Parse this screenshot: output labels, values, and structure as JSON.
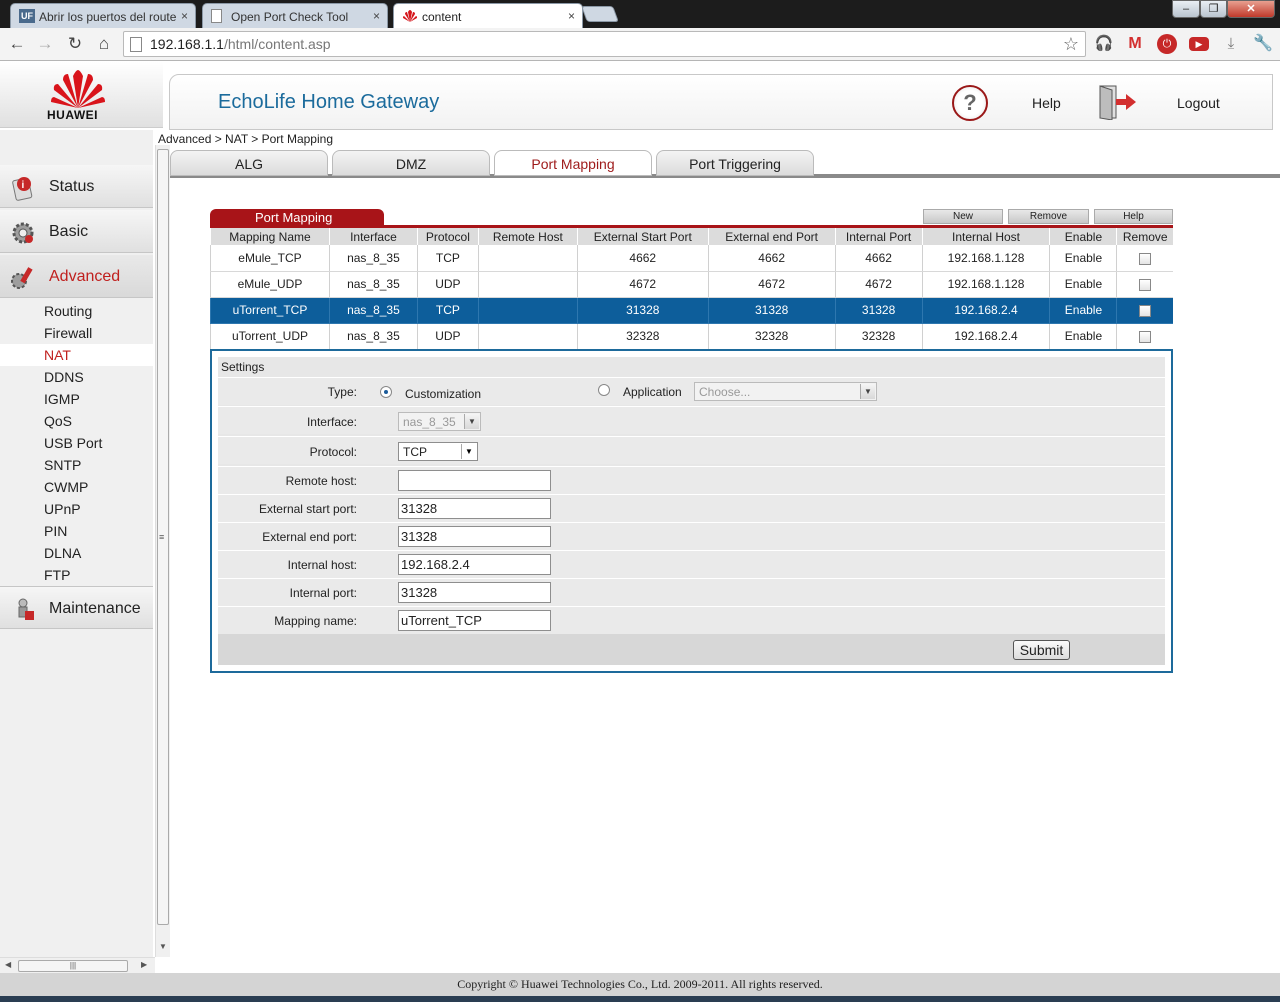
{
  "browser": {
    "tabs": [
      {
        "title": "Abrir los puertos del route",
        "icon": "uf-favicon-icon",
        "active": false
      },
      {
        "title": "Open Port Check Tool",
        "icon": "page-icon",
        "active": false
      },
      {
        "title": "content",
        "icon": "huawei-favicon-icon",
        "active": true
      }
    ],
    "close_glyph": "×",
    "url_host": "192.168.1.1",
    "url_path": "/html/content.asp"
  },
  "brand": {
    "logo_text": "HUAWEI",
    "title": "EchoLife Home Gateway",
    "help_label": "Help",
    "logout_label": "Logout"
  },
  "sidebar": {
    "main": [
      {
        "label": "Status",
        "active": false
      },
      {
        "label": "Basic",
        "active": false
      },
      {
        "label": "Advanced",
        "active": true
      }
    ],
    "sub": [
      {
        "label": "Routing",
        "active": false
      },
      {
        "label": "Firewall",
        "active": false
      },
      {
        "label": "NAT",
        "active": true
      },
      {
        "label": "DDNS",
        "active": false
      },
      {
        "label": "IGMP",
        "active": false
      },
      {
        "label": "QoS",
        "active": false
      },
      {
        "label": "USB Port",
        "active": false
      },
      {
        "label": "SNTP",
        "active": false
      },
      {
        "label": "CWMP",
        "active": false
      },
      {
        "label": "UPnP",
        "active": false
      },
      {
        "label": "PIN",
        "active": false
      },
      {
        "label": "DLNA",
        "active": false
      },
      {
        "label": "FTP",
        "active": false
      }
    ],
    "maintenance": "Maintenance"
  },
  "breadcrumb": "Advanced > NAT > Port Mapping",
  "page_tabs": [
    {
      "label": "ALG",
      "active": false
    },
    {
      "label": "DMZ",
      "active": false
    },
    {
      "label": "Port Mapping",
      "active": true
    },
    {
      "label": "Port Triggering",
      "active": false
    }
  ],
  "port_mapping": {
    "section_title": "Port Mapping",
    "buttons": {
      "new": "New",
      "remove": "Remove",
      "help": "Help"
    },
    "columns": [
      "Mapping Name",
      "Interface",
      "Protocol",
      "Remote Host",
      "External Start Port",
      "External end Port",
      "Internal Port",
      "Internal Host",
      "Enable",
      "Remove"
    ],
    "rows": [
      {
        "name": "eMule_TCP",
        "interface": "nas_8_35",
        "protocol": "TCP",
        "remote_host": "",
        "ext_start": "4662",
        "ext_end": "4662",
        "int_port": "4662",
        "int_host": "192.168.1.128",
        "enable": "Enable",
        "selected": false
      },
      {
        "name": "eMule_UDP",
        "interface": "nas_8_35",
        "protocol": "UDP",
        "remote_host": "",
        "ext_start": "4672",
        "ext_end": "4672",
        "int_port": "4672",
        "int_host": "192.168.1.128",
        "enable": "Enable",
        "selected": false
      },
      {
        "name": "uTorrent_TCP",
        "interface": "nas_8_35",
        "protocol": "TCP",
        "remote_host": "",
        "ext_start": "31328",
        "ext_end": "31328",
        "int_port": "31328",
        "int_host": "192.168.2.4",
        "enable": "Enable",
        "selected": true
      },
      {
        "name": "uTorrent_UDP",
        "interface": "nas_8_35",
        "protocol": "UDP",
        "remote_host": "",
        "ext_start": "32328",
        "ext_end": "32328",
        "int_port": "32328",
        "int_host": "192.168.2.4",
        "enable": "Enable",
        "selected": false
      }
    ]
  },
  "settings": {
    "title": "Settings",
    "type_label": "Type:",
    "type_customization": "Customization",
    "type_application": "Application",
    "application_placeholder": "Choose...",
    "interface_label": "Interface:",
    "interface_value": "nas_8_35",
    "protocol_label": "Protocol:",
    "protocol_value": "TCP",
    "remote_host_label": "Remote host:",
    "remote_host_value": "",
    "ext_start_label": "External start port:",
    "ext_start_value": "31328",
    "ext_end_label": "External end port:",
    "ext_end_value": "31328",
    "int_host_label": "Internal host:",
    "int_host_value": "192.168.2.4",
    "int_port_label": "Internal port:",
    "int_port_value": "31328",
    "mapping_name_label": "Mapping name:",
    "mapping_name_value": "uTorrent_TCP",
    "submit": "Submit"
  },
  "footer": "Copyright © Huawei Technologies Co., Ltd.  2009-2011. All rights reserved.",
  "colors": {
    "brand_red": "#a81418",
    "selected_row": "#0d5e9b",
    "title_blue": "#1b6b9c"
  }
}
